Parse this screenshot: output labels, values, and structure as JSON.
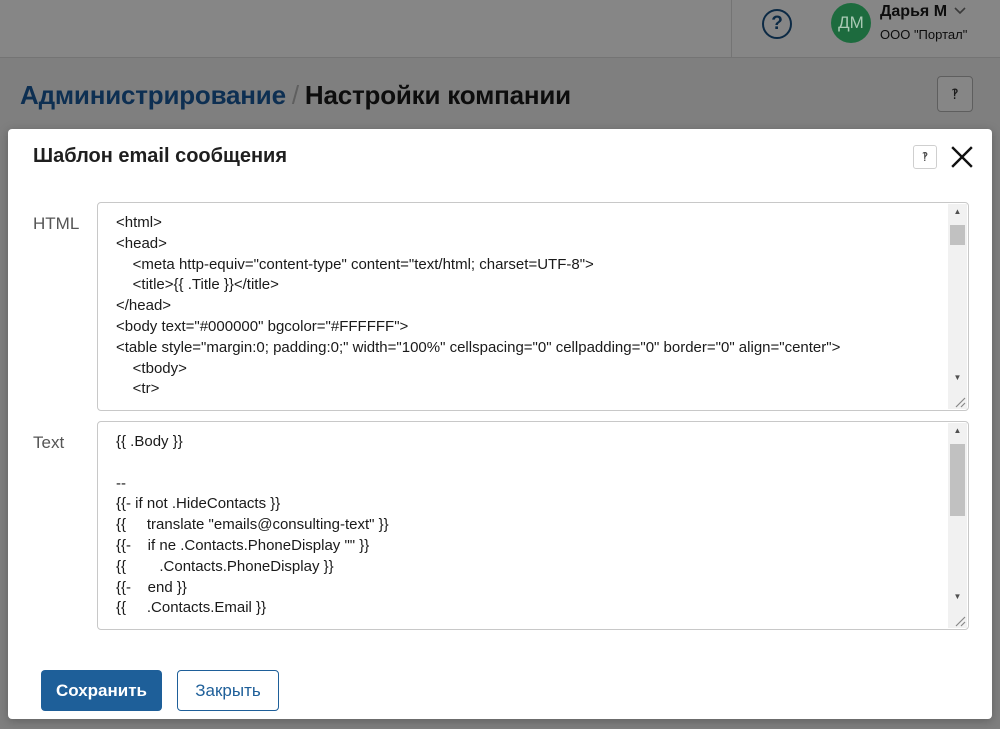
{
  "header": {
    "help_icon": "question-circle-icon",
    "avatar_initials": "ДМ",
    "user_name": "Дарья М",
    "user_chevron": "chevron-down-icon",
    "company": "ООО \"Портал\""
  },
  "breadcrumb": {
    "parent": "Администрирование",
    "separator": "/",
    "current": "Настройки компании",
    "help_icon": "question-icon"
  },
  "modal": {
    "title": "Шаблон email сообщения",
    "help_icon": "question-icon",
    "close_icon": "close-icon",
    "html_label": "HTML",
    "html_value": "<html>\n<head>\n    <meta http-equiv=\"content-type\" content=\"text/html; charset=UTF-8\">\n    <title>{{ .Title }}</title>\n</head>\n<body text=\"#000000\" bgcolor=\"#FFFFFF\">\n<table style=\"margin:0; padding:0;\" width=\"100%\" cellspacing=\"0\" cellpadding=\"0\" border=\"0\" align=\"center\">\n    <tbody>\n    <tr>",
    "text_label": "Text",
    "text_value": "{{ .Body }}\n\n--\n{{- if not .HideContacts }}\n{{     translate \"emails@consulting-text\" }}\n{{-    if ne .Contacts.PhoneDisplay \"\" }}\n{{        .Contacts.PhoneDisplay }}\n{{-    end }}\n{{     .Contacts.Email }}",
    "save_label": "Сохранить",
    "close_label": "Закрыть"
  }
}
